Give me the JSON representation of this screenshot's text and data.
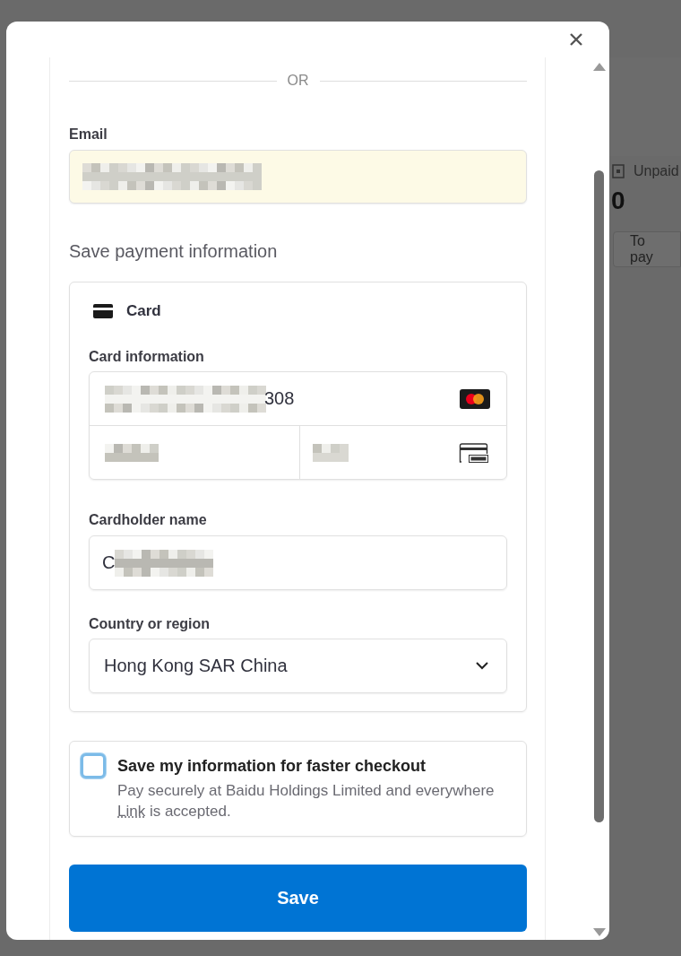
{
  "background_page": {
    "unpaid_label": "Unpaid",
    "unpaid_count": "0",
    "pay_button": "To pay"
  },
  "modal": {
    "divider_text": "OR",
    "email": {
      "label": "Email",
      "autofilled": true
    },
    "section_title": "Save payment information",
    "payment_method": {
      "label": "Card"
    },
    "card_information": {
      "label": "Card information",
      "number_visible": "308"
    },
    "cardholder": {
      "label": "Cardholder name",
      "value_visible": "C"
    },
    "country": {
      "label": "Country or region",
      "value": "Hong Kong SAR China"
    },
    "save_info": {
      "checked": false,
      "title": "Save my information for faster checkout",
      "text_before": "Pay securely at Baidu Holdings Limited and everywhere",
      "link": "Link",
      "text_after": "is accepted."
    },
    "submit_button": "Save"
  }
}
